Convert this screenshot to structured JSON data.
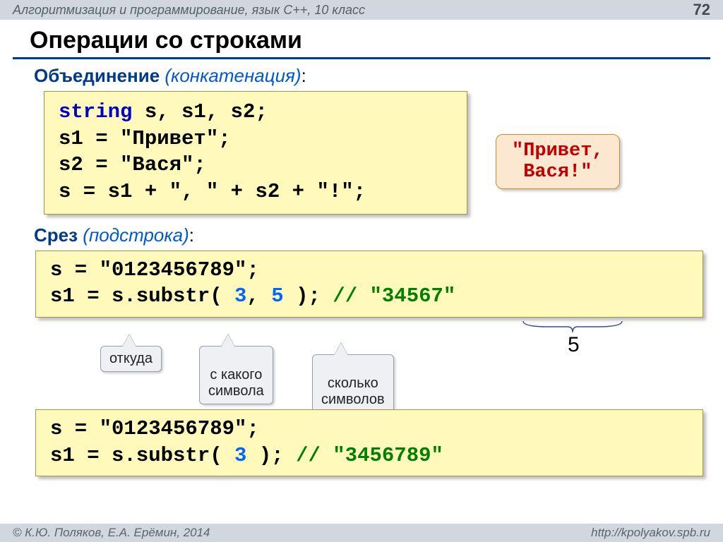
{
  "header": {
    "course": "Алгоритмизация и программирование, язык C++, 10 класс",
    "page": "72"
  },
  "title": "Операции со строками",
  "section1": {
    "label": "Объединение",
    "paren": "(конкатенация)",
    "colon": ":"
  },
  "code1": {
    "kw": "string",
    "rest1": " s, s1, s2;",
    "l2": "s1 = \"Привет\";",
    "l3": "s2 = \"Вася\";",
    "l4": "s = s1 + \", \" + s2 + \"!\";"
  },
  "callout1": {
    "l1": "\"Привет,",
    "l2": "Вася!\""
  },
  "section2": {
    "label": "Срез",
    "paren": "(подстрока)",
    "colon": ":"
  },
  "code2": {
    "l1": "s = \"0123456789\";",
    "pre2": "s1 = s.substr( ",
    "n1": "3",
    "mid2": ", ",
    "n2": "5",
    "post2": " );",
    "cmt2": "   // \"34567\""
  },
  "brace_count": "5",
  "bubbles": {
    "b1": "откуда",
    "b2": "с какого\nсимвола",
    "b3": "сколько\nсимволов"
  },
  "code3": {
    "l1": "s = \"0123456789\";",
    "pre2": "s1 = s.substr( ",
    "n1": "3",
    "post2": " );",
    "cmt2": "   // \"3456789\""
  },
  "footer": {
    "left": "© К.Ю. Поляков, Е.А. Ерёмин, 2014",
    "right": "http://kpolyakov.spb.ru"
  }
}
